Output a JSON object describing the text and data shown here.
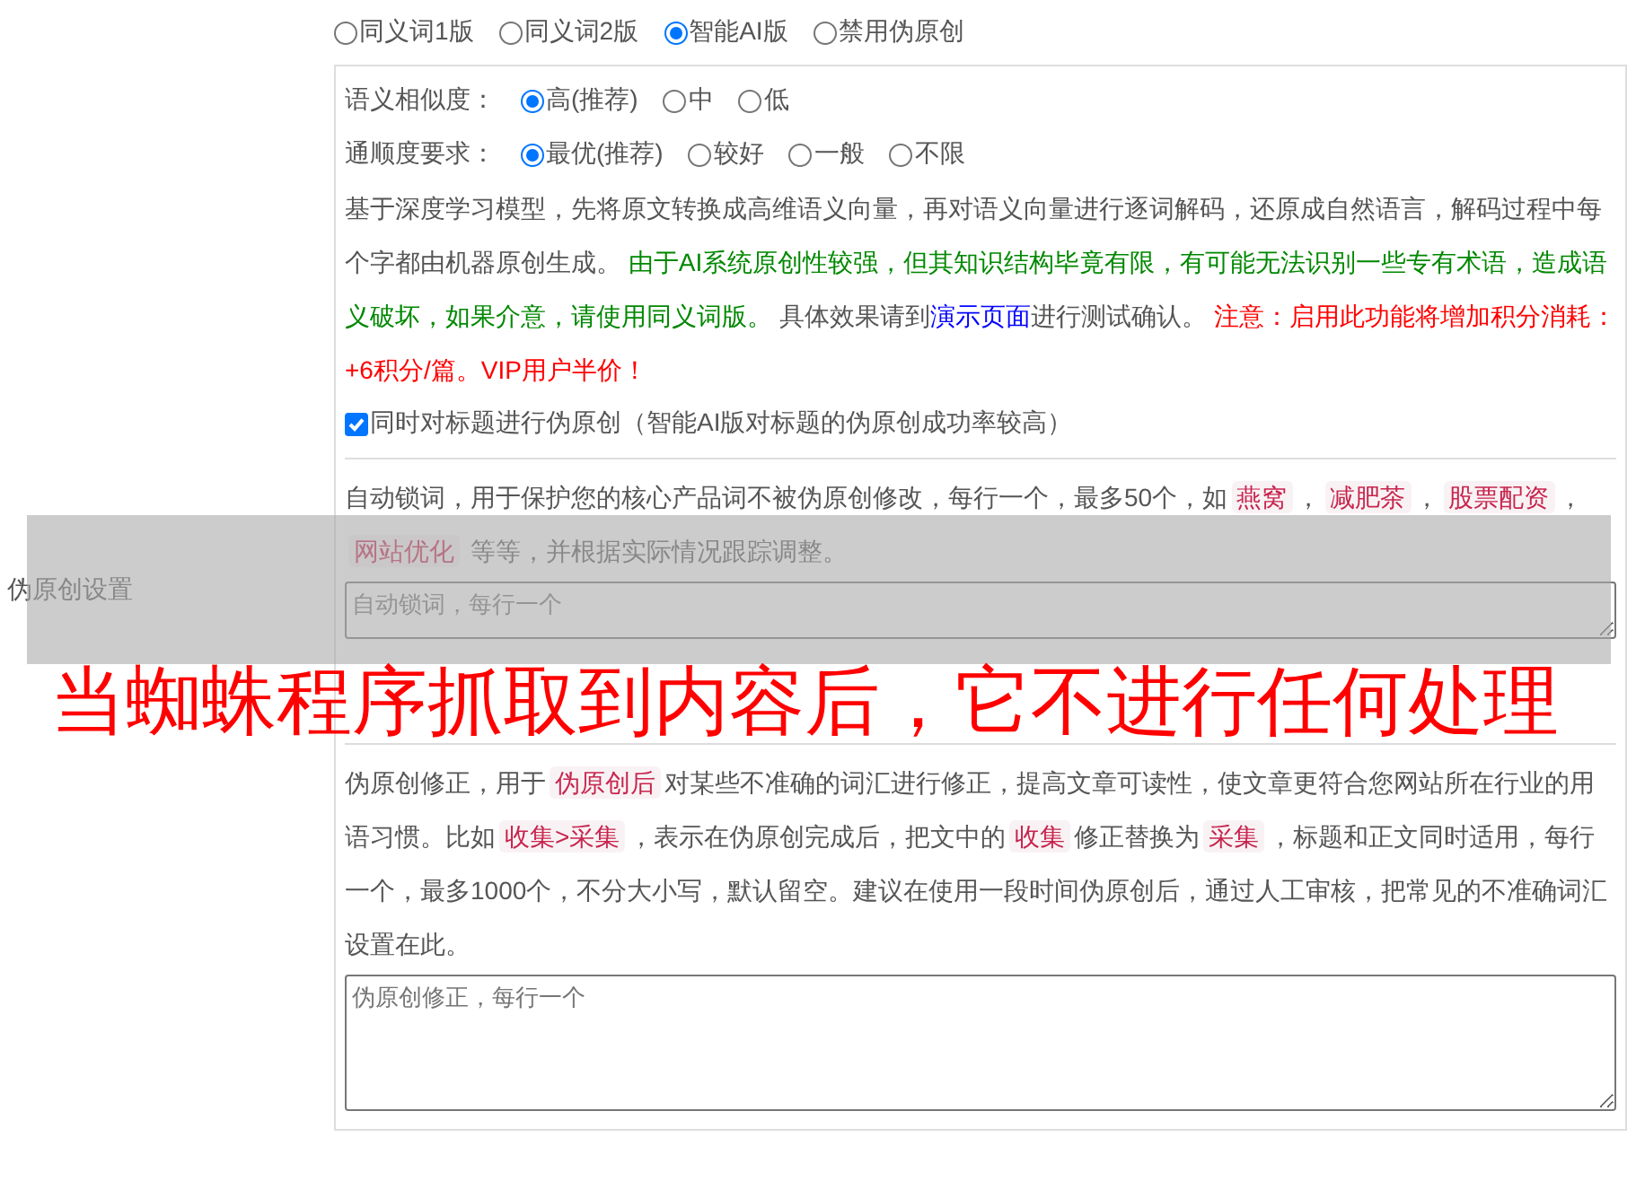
{
  "section_label": "伪原创设置",
  "modes": [
    {
      "label": "同义词1版",
      "selected": false
    },
    {
      "label": "同义词2版",
      "selected": false
    },
    {
      "label": "智能AI版",
      "selected": true
    },
    {
      "label": "禁用伪原创",
      "selected": false
    }
  ],
  "settings": [
    {
      "label": "语义相似度：",
      "options": [
        {
          "label": "高(推荐)",
          "selected": true
        },
        {
          "label": "中",
          "selected": false
        },
        {
          "label": "低",
          "selected": false
        }
      ]
    },
    {
      "label": "通顺度要求：",
      "options": [
        {
          "label": "最优(推荐)",
          "selected": true
        },
        {
          "label": "较好",
          "selected": false
        },
        {
          "label": "一般",
          "selected": false
        },
        {
          "label": "不限",
          "selected": false
        }
      ]
    }
  ],
  "ai_description": [
    {
      "kind": "text",
      "text": "基于深度学习模型，先将原文转换成高维语义向量，再对语义向量进行逐词解码，还原成自然语言，解码过程中每个字都由机器原创生成。 "
    },
    {
      "kind": "note",
      "text": "由于AI系统原创性较强，但其知识结构毕竟有限，有可能无法识别一些专有术语，造成语义破坏，如果介意，请使用同义词版。"
    },
    {
      "kind": "text",
      "text": " 具体效果请到"
    },
    {
      "kind": "link",
      "text": "演示页面"
    },
    {
      "kind": "text",
      "text": "进行测试确认。 "
    },
    {
      "kind": "warning",
      "text": "注意：启用此功能将增加积分消耗：+6积分/篇。VIP用户半价！"
    }
  ],
  "title_checkbox": {
    "label": "同时对标题进行伪原创（智能AI版对标题的伪原创成功率较高）",
    "checked": true
  },
  "lock_words": {
    "description": [
      {
        "kind": "text",
        "text": "自动锁词，用于保护您的核心产品词不被伪原创修改，每行一个，最多50个，如"
      },
      {
        "kind": "code",
        "text": "燕窝"
      },
      {
        "kind": "text",
        "text": "，"
      },
      {
        "kind": "code",
        "text": "减肥茶"
      },
      {
        "kind": "text",
        "text": "，"
      },
      {
        "kind": "code",
        "text": "股票配资"
      },
      {
        "kind": "text",
        "text": "，"
      },
      {
        "kind": "code",
        "text": "网站优化"
      },
      {
        "kind": "text",
        "text": " 等等，并根据实际情况跟踪调整。"
      }
    ],
    "placeholder": "自动锁词，每行一个"
  },
  "corrections": {
    "description": [
      {
        "kind": "text",
        "text": "伪原创修正，用于"
      },
      {
        "kind": "code",
        "text": "伪原创后"
      },
      {
        "kind": "text",
        "text": "对某些不准确的词汇进行修正，提高文章可读性，使文章更符合您网站所在行业的用语习惯。比如"
      },
      {
        "kind": "code",
        "text": "收集>采集"
      },
      {
        "kind": "text",
        "text": "，表示在伪原创完成后，把文中的"
      },
      {
        "kind": "code",
        "text": "收集"
      },
      {
        "kind": "text",
        "text": "修正替换为"
      },
      {
        "kind": "code",
        "text": "采集"
      },
      {
        "kind": "text",
        "text": "，标题和正文同时适用，每行一个，最多1000个，不分大小写，默认留空。建议在使用一段时间伪原创后，通过人工审核，把常见的不准确词汇设置在此。"
      }
    ],
    "placeholder": "伪原创修正，每行一个"
  },
  "overlay_caption": "当蜘蛛程序抓取到内容后，它不进行任何处理"
}
